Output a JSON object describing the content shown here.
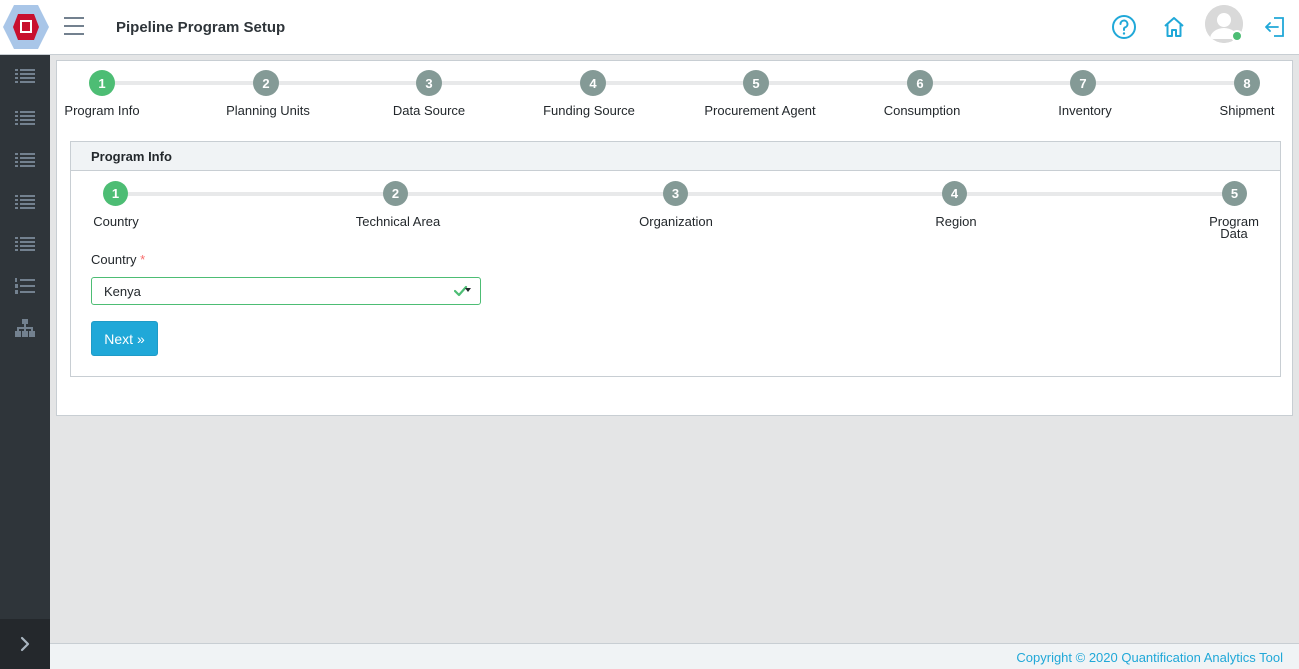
{
  "header": {
    "title": "Pipeline Program Setup",
    "icons": [
      "help-icon",
      "home-icon",
      "user-avatar",
      "logout-icon"
    ]
  },
  "sidebar": {
    "items": [
      "list-icon",
      "list-icon",
      "list-icon",
      "list-icon",
      "list-icon",
      "numbered-list-icon",
      "sitemap-icon"
    ],
    "toggle": "chevron-right-icon"
  },
  "main_steps": [
    {
      "num": "1",
      "label": "Program Info",
      "active": true
    },
    {
      "num": "2",
      "label": "Planning Units",
      "active": false
    },
    {
      "num": "3",
      "label": "Data Source",
      "active": false
    },
    {
      "num": "4",
      "label": "Funding Source",
      "active": false
    },
    {
      "num": "5",
      "label": "Procurement Agent",
      "active": false
    },
    {
      "num": "6",
      "label": "Consumption",
      "active": false
    },
    {
      "num": "7",
      "label": "Inventory",
      "active": false
    },
    {
      "num": "8",
      "label": "Shipment",
      "active": false
    }
  ],
  "panel": {
    "title": "Program Info",
    "sub_steps": [
      {
        "num": "1",
        "label": "Country",
        "active": true
      },
      {
        "num": "2",
        "label": "Technical Area",
        "active": false
      },
      {
        "num": "3",
        "label": "Organization",
        "active": false
      },
      {
        "num": "4",
        "label": "Region",
        "active": false
      },
      {
        "num": "5",
        "label": "Program Data",
        "active": false
      }
    ],
    "country_label": "Country",
    "required_mark": "*",
    "country_value": "Kenya",
    "next_label": "Next »"
  },
  "footer": {
    "copyright": "Copyright © 2020 Quantification Analytics Tool"
  },
  "colors": {
    "accent": "#20a8d8",
    "active_step": "#4dbd74",
    "inactive_step": "#849a96",
    "sidebar": "#2f353a"
  }
}
